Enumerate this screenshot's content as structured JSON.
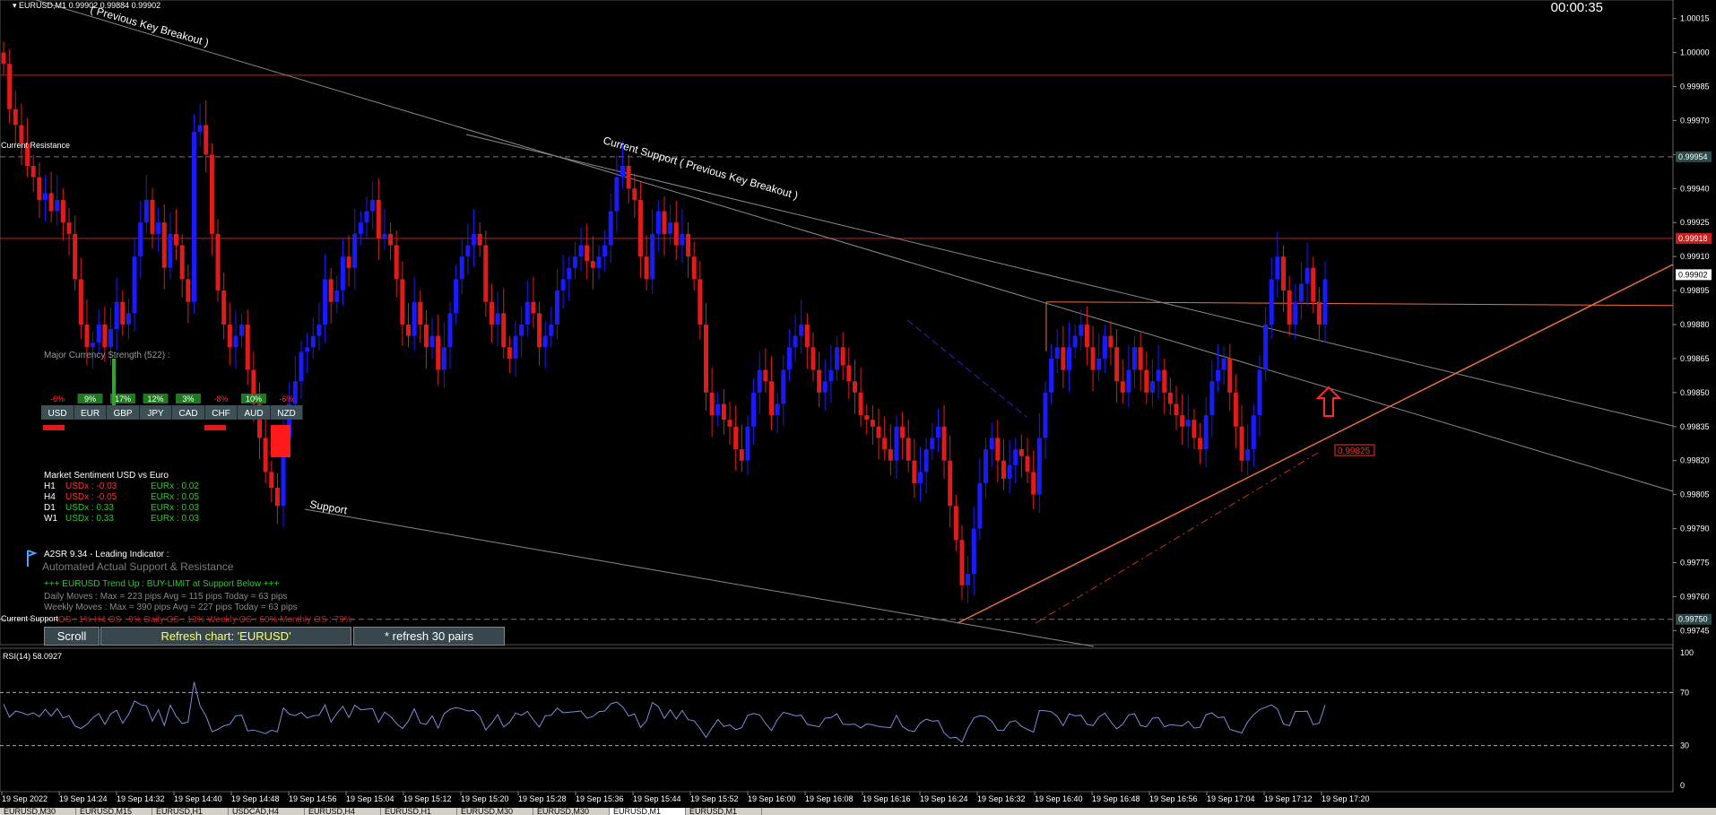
{
  "window": {
    "symbol_line": "EURUSD,M1",
    "quotes": "0.99902 0.99884 0.99902",
    "countdown": "00:00:35"
  },
  "chart_data": {
    "type": "candlestick",
    "symbol": "EURUSD",
    "timeframe": "M1",
    "price_axis": {
      "ylim": [
        0.9974,
        1.0002
      ],
      "ticks": [
        "1.00015",
        "1.00000",
        "0.99985",
        "0.99970",
        "0.99955",
        "0.99940",
        "0.99925",
        "0.99910",
        "0.99895",
        "0.99880",
        "0.99865",
        "0.99850",
        "0.99835",
        "0.99820",
        "0.99805",
        "0.99790",
        "0.99775",
        "0.99760",
        "0.99745"
      ]
    },
    "price_labels": [
      {
        "text": "0.99954",
        "kind": "resistance",
        "price": 0.99954
      },
      {
        "text": "0.99918",
        "kind": "support-line",
        "price": 0.99918
      },
      {
        "text": "0.99902",
        "kind": "bid",
        "price": 0.99902
      },
      {
        "text": "0.99750",
        "kind": "current-support",
        "price": 0.9975
      }
    ],
    "time_axis": [
      "19 Sep 2022",
      "19 Sep 14:24",
      "19 Sep 14:32",
      "19 Sep 14:40",
      "19 Sep 14:48",
      "19 Sep 14:56",
      "19 Sep 15:04",
      "19 Sep 15:12",
      "19 Sep 15:20",
      "19 Sep 15:28",
      "19 Sep 15:36",
      "19 Sep 15:44",
      "19 Sep 15:52",
      "19 Sep 16:00",
      "19 Sep 16:08",
      "19 Sep 16:16",
      "19 Sep 16:24",
      "19 Sep 16:32",
      "19 Sep 16:40",
      "19 Sep 16:48",
      "19 Sep 16:56",
      "19 Sep 17:04",
      "19 Sep 17:12",
      "19 Sep 17:20"
    ],
    "levels": {
      "top_red": 0.9999,
      "resistance": 0.99954,
      "red_line": 0.99918,
      "orange_flat": 0.9989,
      "support_dash": 0.9975,
      "projection_label": "0.99825",
      "projection_price": 0.99825
    },
    "annotations": {
      "current_resistance": "Current Resistance",
      "current_support": "Current Support",
      "support": "Support",
      "key_breakout_top": "( Previous Key Breakout )",
      "key_breakout_mid": "Current Support ( Previous Key Breakout )"
    },
    "candles_close": [
      0.99995,
      0.99975,
      0.99968,
      0.9996,
      0.9995,
      0.99945,
      0.99935,
      0.99938,
      0.9993,
      0.99935,
      0.99925,
      0.9992,
      0.999,
      0.9988,
      0.9987,
      0.99872,
      0.9988,
      0.9987,
      0.99878,
      0.9989,
      0.9988,
      0.99885,
      0.9991,
      0.99925,
      0.99935,
      0.9992,
      0.99925,
      0.99905,
      0.9992,
      0.99915,
      0.999,
      0.9989,
      0.99965,
      0.99968,
      0.99955,
      0.9992,
      0.99895,
      0.9988,
      0.9987,
      0.99875,
      0.9988,
      0.9986,
      0.99845,
      0.9983,
      0.99815,
      0.99808,
      0.998,
      0.9983,
      0.99845,
      0.99855,
      0.99868,
      0.9987,
      0.99875,
      0.9988,
      0.999,
      0.9989,
      0.99895,
      0.9991,
      0.99905,
      0.9992,
      0.99925,
      0.9993,
      0.99935,
      0.99918,
      0.9992,
      0.99915,
      0.999,
      0.9988,
      0.99875,
      0.9989,
      0.9988,
      0.9987,
      0.99875,
      0.9986,
      0.9987,
      0.99885,
      0.999,
      0.9991,
      0.99915,
      0.9992,
      0.99915,
      0.9989,
      0.9988,
      0.99885,
      0.9987,
      0.99865,
      0.99875,
      0.9988,
      0.9989,
      0.99885,
      0.9987,
      0.99875,
      0.9988,
      0.99895,
      0.999,
      0.99905,
      0.9991,
      0.99915,
      0.99908,
      0.99905,
      0.9991,
      0.99915,
      0.9993,
      0.99945,
      0.9995,
      0.9994,
      0.99935,
      0.9991,
      0.999,
      0.9992,
      0.9993,
      0.9992,
      0.99925,
      0.99915,
      0.9992,
      0.9991,
      0.999,
      0.9988,
      0.9985,
      0.9984,
      0.99845,
      0.99838,
      0.99835,
      0.99825,
      0.9982,
      0.99835,
      0.9985,
      0.9986,
      0.99855,
      0.9984,
      0.99845,
      0.9986,
      0.9987,
      0.99875,
      0.9988,
      0.9987,
      0.9986,
      0.9985,
      0.99855,
      0.9986,
      0.9987,
      0.99862,
      0.99855,
      0.9985,
      0.9984,
      0.99838,
      0.99835,
      0.9983,
      0.99825,
      0.9982,
      0.99835,
      0.9983,
      0.9982,
      0.9981,
      0.99815,
      0.99825,
      0.9983,
      0.99835,
      0.9982,
      0.998,
      0.99785,
      0.99765,
      0.9977,
      0.9979,
      0.9981,
      0.99825,
      0.9983,
      0.9982,
      0.99812,
      0.99818,
      0.99825,
      0.99822,
      0.99815,
      0.99805,
      0.9983,
      0.9985,
      0.99865,
      0.9987,
      0.9986,
      0.9987,
      0.99875,
      0.9988,
      0.9987,
      0.9986,
      0.99865,
      0.99875,
      0.9987,
      0.99855,
      0.9985,
      0.9986,
      0.9987,
      0.9986,
      0.9985,
      0.99855,
      0.9986,
      0.9985,
      0.99845,
      0.9984,
      0.99835,
      0.99838,
      0.9983,
      0.99825,
      0.9984,
      0.99855,
      0.9986,
      0.99865,
      0.9985,
      0.99835,
      0.9982,
      0.99825,
      0.9984,
      0.9986,
      0.9988,
      0.999,
      0.9991,
      0.99895,
      0.9988,
      0.9989,
      0.99898,
      0.99905,
      0.9989,
      0.9988,
      0.999
    ]
  },
  "rsi": {
    "label": "RSI(14) 58.0927",
    "ticks": [
      "100",
      "70",
      "30",
      "0"
    ],
    "levels": [
      70,
      30
    ]
  },
  "currency_strength": {
    "title": "Major Currency Strength (522) :",
    "currencies": [
      {
        "name": "USD",
        "value": "-6%"
      },
      {
        "name": "EUR",
        "value": "9%"
      },
      {
        "name": "GBP",
        "value": "17%"
      },
      {
        "name": "JPY",
        "value": "12%"
      },
      {
        "name": "CAD",
        "value": "3%"
      },
      {
        "name": "CHF",
        "value": "-8%"
      },
      {
        "name": "AUD",
        "value": "10%"
      },
      {
        "name": "NZD",
        "value": "-6%"
      }
    ]
  },
  "sentiment": {
    "title": "Market Sentiment USD vs Euro",
    "rows": [
      {
        "tf": "H1",
        "usd": "USDx : -0.03",
        "eur": "EURx : 0.02",
        "usd_neg": true
      },
      {
        "tf": "H4",
        "usd": "USDx : -0.05",
        "eur": "EURx : 0.05",
        "usd_neg": true
      },
      {
        "tf": "D1",
        "usd": "USDx : 0.33",
        "eur": "EURx : 0.03",
        "usd_neg": false
      },
      {
        "tf": "W1",
        "usd": "USDx : 0.33",
        "eur": "EURx : 0.03",
        "usd_neg": false
      }
    ]
  },
  "indicator": {
    "title": "A2SR 9.34 - Leading Indicator :",
    "subtitle": "Automated Actual Support & Resistance",
    "trend": "+++ EURUSD Trend Up : BUY-LIMIT at Support Below +++",
    "daily": "Daily Moves     : Max = 223 pips Avg = 115 pips Today = 63 pips",
    "weekly": "Weekly Moves : Max = 390 pips Avg = 227 pips Today = 63 pips",
    "os_line": "OS : 1%        H4 OS : 9%        Daily OS : 13%      Weekly OS : 60%        Monthly OS : 79%"
  },
  "buttons": {
    "scroll": "Scroll",
    "refresh": "Refresh chart: 'EURUSD'",
    "refresh30": "* refresh 30 pairs"
  },
  "tabs": [
    "EURUSD,M30",
    "EURUSD,M15",
    "EURUSD,H1",
    "USDCAD,H4",
    "EURUSD,H4",
    "EURUSD,H1",
    "EURUSD,M30",
    "EURUSD,M30",
    "EURUSD,M1",
    "EURUSD,M1"
  ],
  "colors": {
    "bull": "#1a1aff",
    "bear": "#e01b1b",
    "red_line": "#c81e1e",
    "orange": "#e8703a",
    "grid_text": "#ffffff",
    "rsi_line": "#7a8fd8"
  }
}
